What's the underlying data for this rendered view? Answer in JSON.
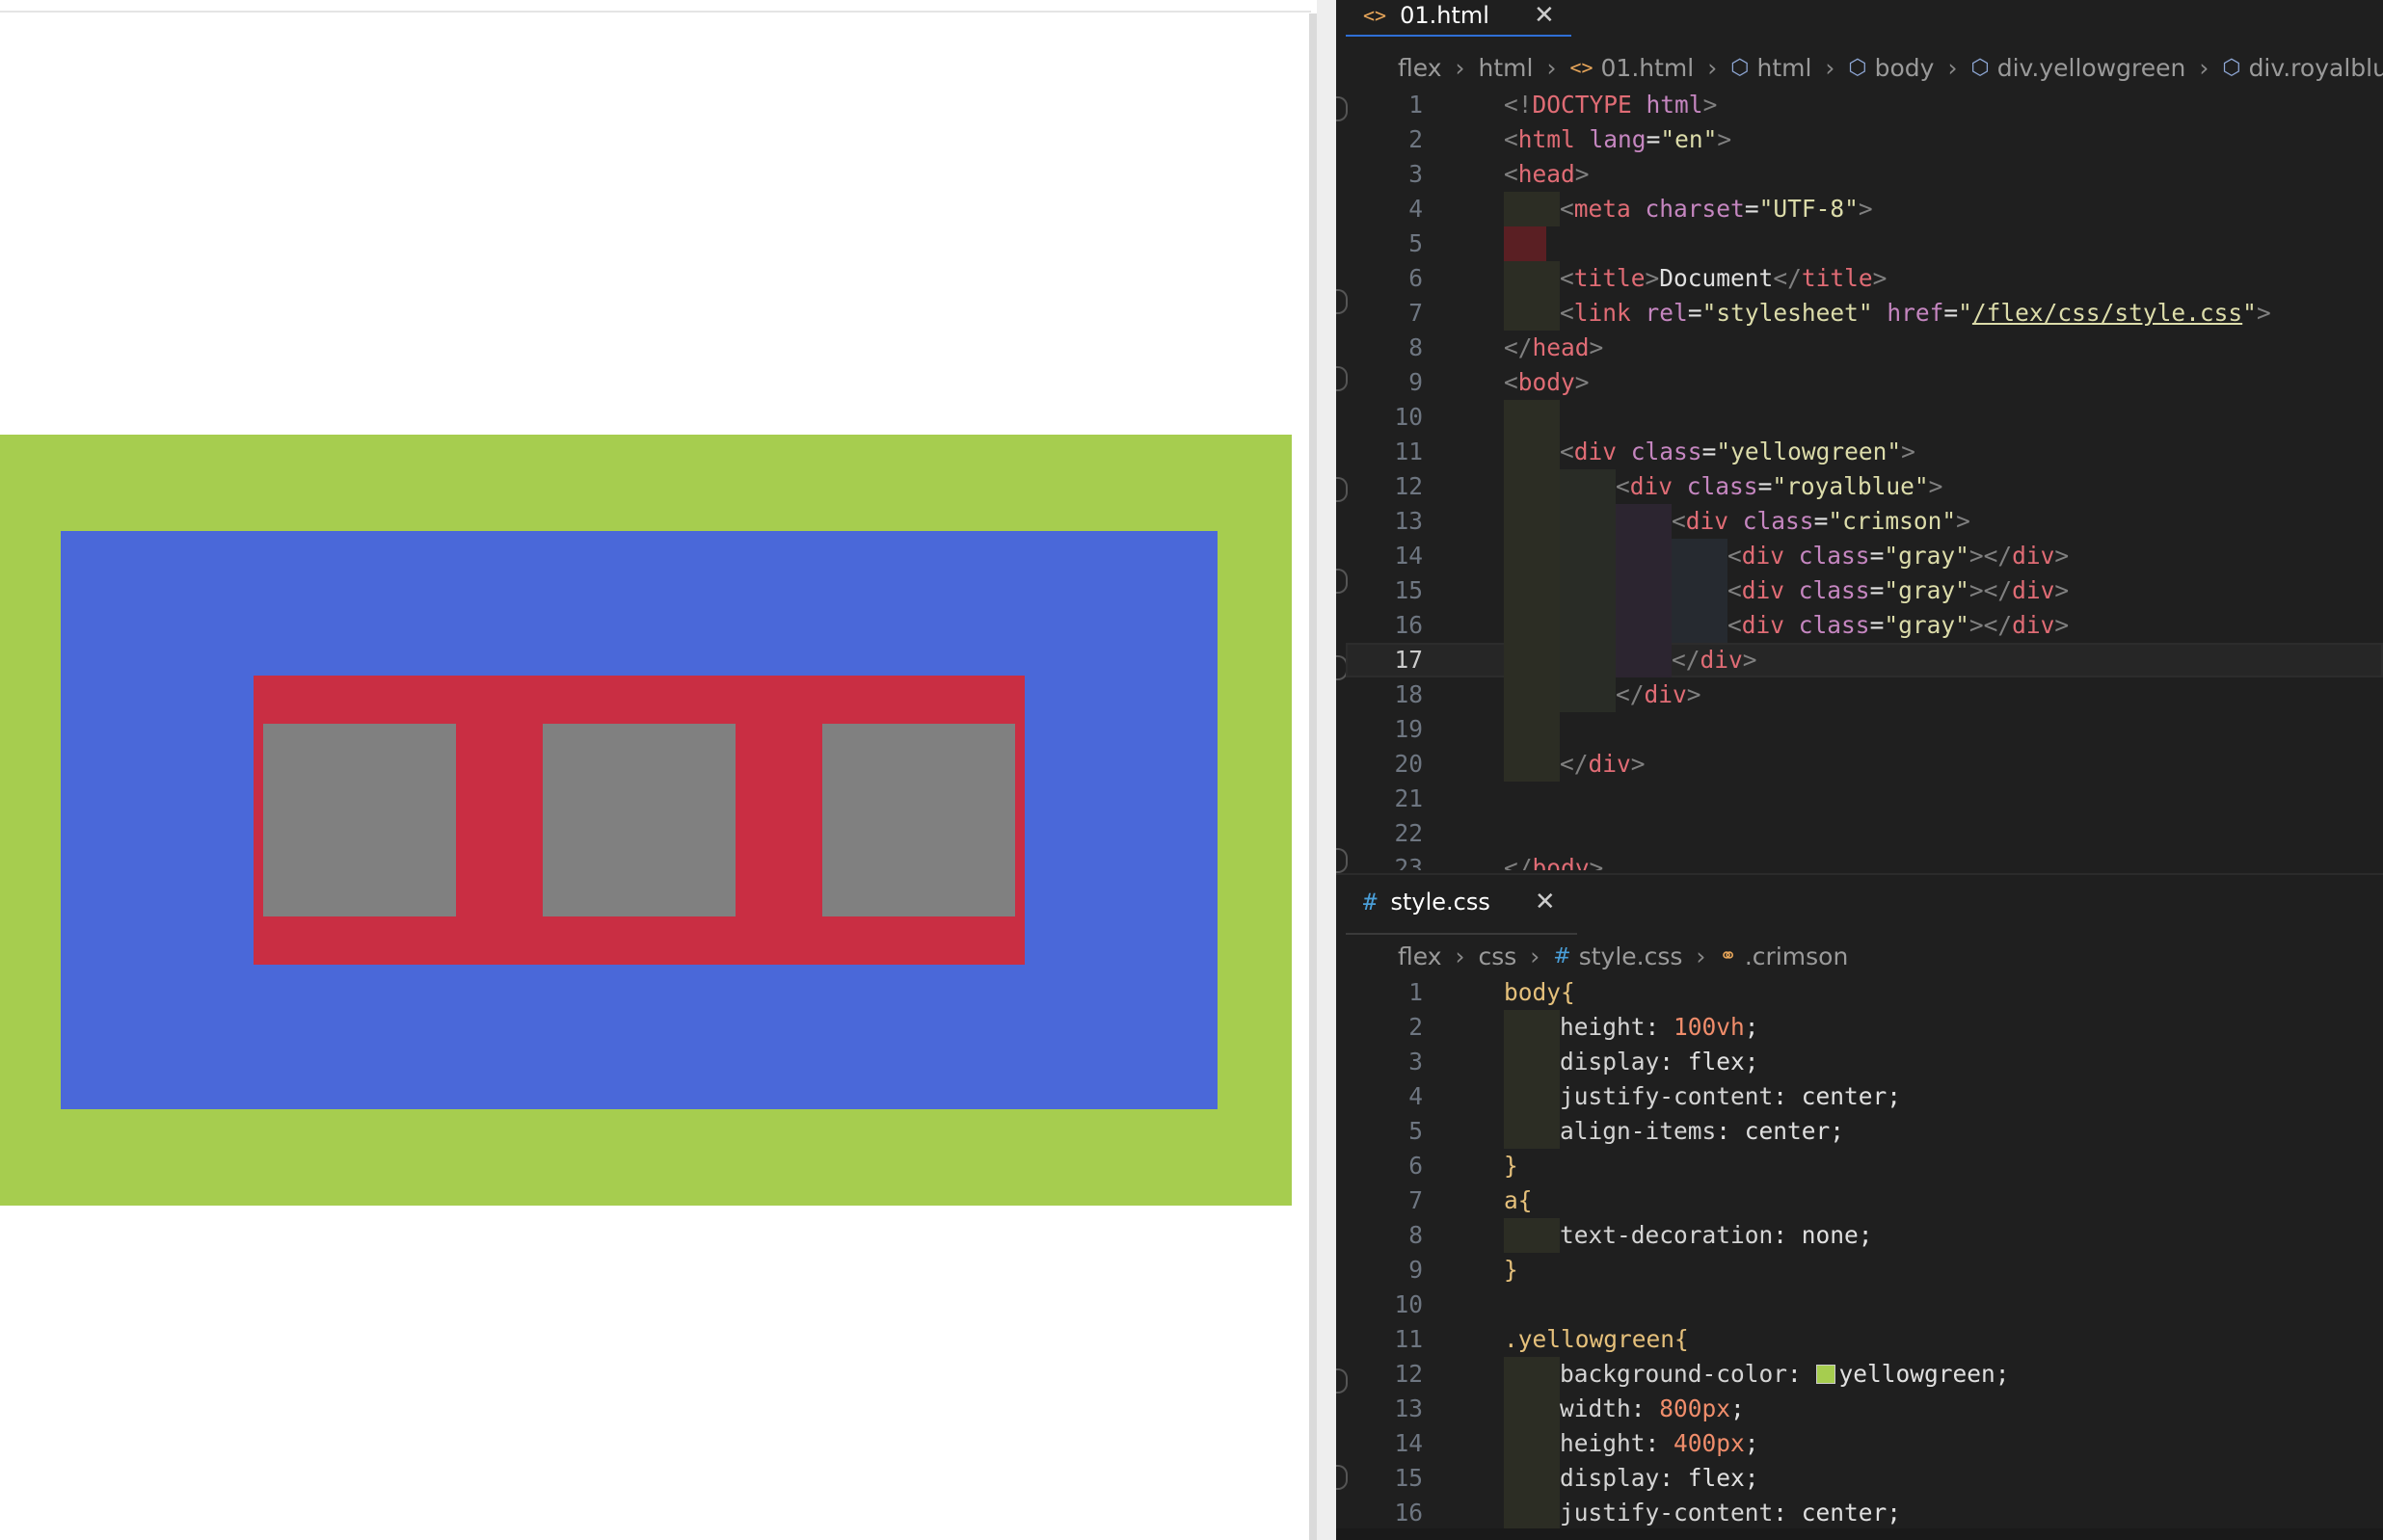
{
  "preview": {
    "colors": {
      "yellowgreen": "#a6cd4f",
      "royalblue": "#4a68d9",
      "crimson": "#c92e43",
      "gray": "#808080"
    },
    "gray_boxes": 3
  },
  "html_pane": {
    "tab": {
      "icon": "html-file-icon",
      "label": "01.html",
      "close": "✕"
    },
    "breadcrumb": [
      "flex",
      "html",
      "01.html",
      "html",
      "body",
      "div.yellowgreen",
      "div.royalblue"
    ],
    "current_line": 17
  },
  "css_pane": {
    "tab": {
      "icon": "css-file-icon",
      "label": "style.css",
      "close": "✕"
    },
    "breadcrumb": [
      "flex",
      "css",
      "style.css",
      ".crimson"
    ]
  },
  "colors": {
    "tab_underline": "#2f6fd6",
    "editor_bg": "#1f1f1f",
    "current_line": "#262626"
  }
}
